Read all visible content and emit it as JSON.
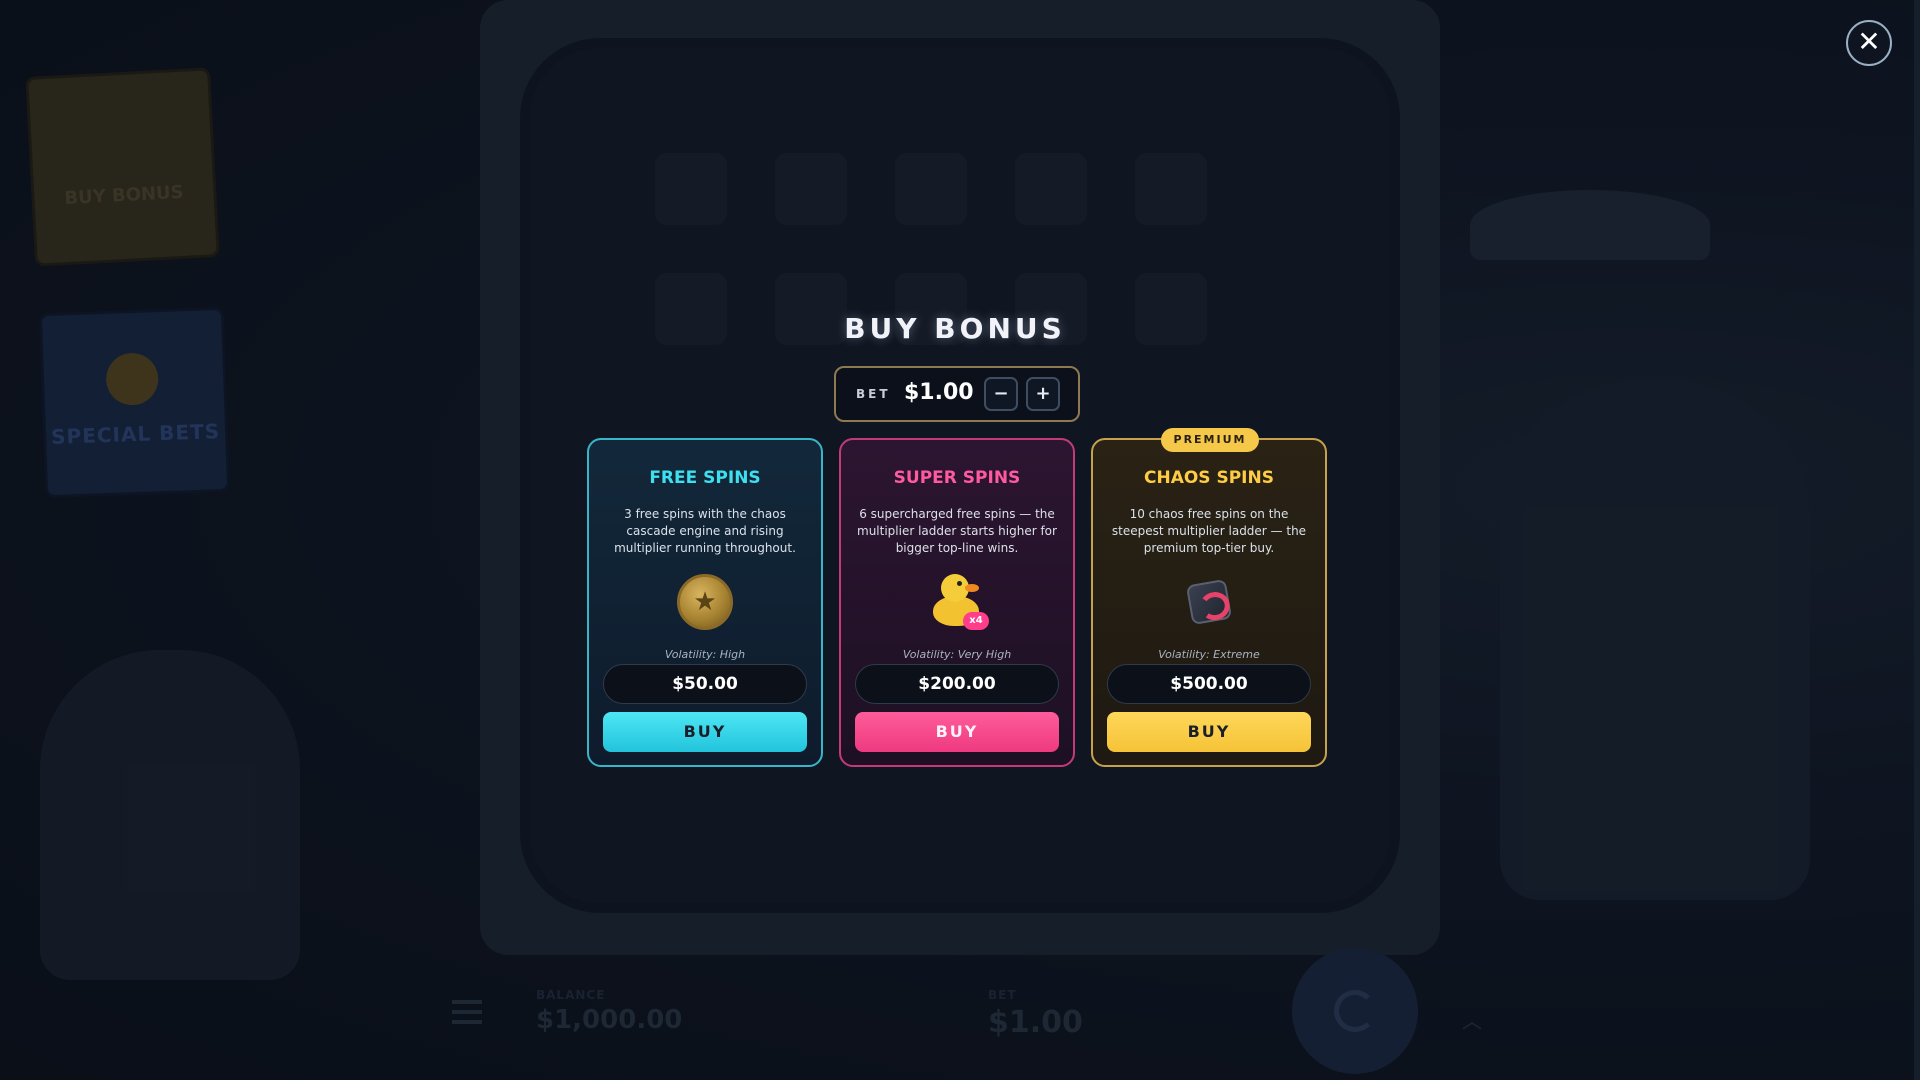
{
  "title": "BUY BONUS",
  "close_label": "✕",
  "bet": {
    "label": "BET",
    "value": "$1.00",
    "minus_label": "−",
    "plus_label": "+"
  },
  "cards": [
    {
      "title": "FREE SPINS",
      "description": "3 free spins with the chaos cascade engine and rising multiplier running throughout.",
      "icon": "coin-icon",
      "volatility": "Volatility: High",
      "price": "$50.00",
      "buy_label": "BUY",
      "accent": "#3ee0f0"
    },
    {
      "title": "SUPER SPINS",
      "description": "6 supercharged free spins — the multiplier ladder starts higher for bigger top-line wins.",
      "icon": "rubber-duck-icon",
      "icon_badge": "x4",
      "volatility": "Volatility: Very High",
      "price": "$200.00",
      "buy_label": "BUY",
      "accent": "#ff5aa0"
    },
    {
      "title": "CHAOS SPINS",
      "badge": "PREMIUM",
      "description": "10 chaos free spins on the steepest multiplier ladder — the premium top-tier buy.",
      "icon": "chaos-swirl-icon",
      "volatility": "Volatility: Extreme",
      "price": "$500.00",
      "buy_label": "BUY",
      "accent": "#ffcd45"
    }
  ],
  "background": {
    "left_panel_bonus": "BUY BONUS",
    "left_panel_special": "SPECIAL BETS",
    "hud": {
      "balance_label": "BALANCE",
      "balance_value": "$1,000.00",
      "bet_label": "BET",
      "bet_value": "$1.00"
    }
  }
}
